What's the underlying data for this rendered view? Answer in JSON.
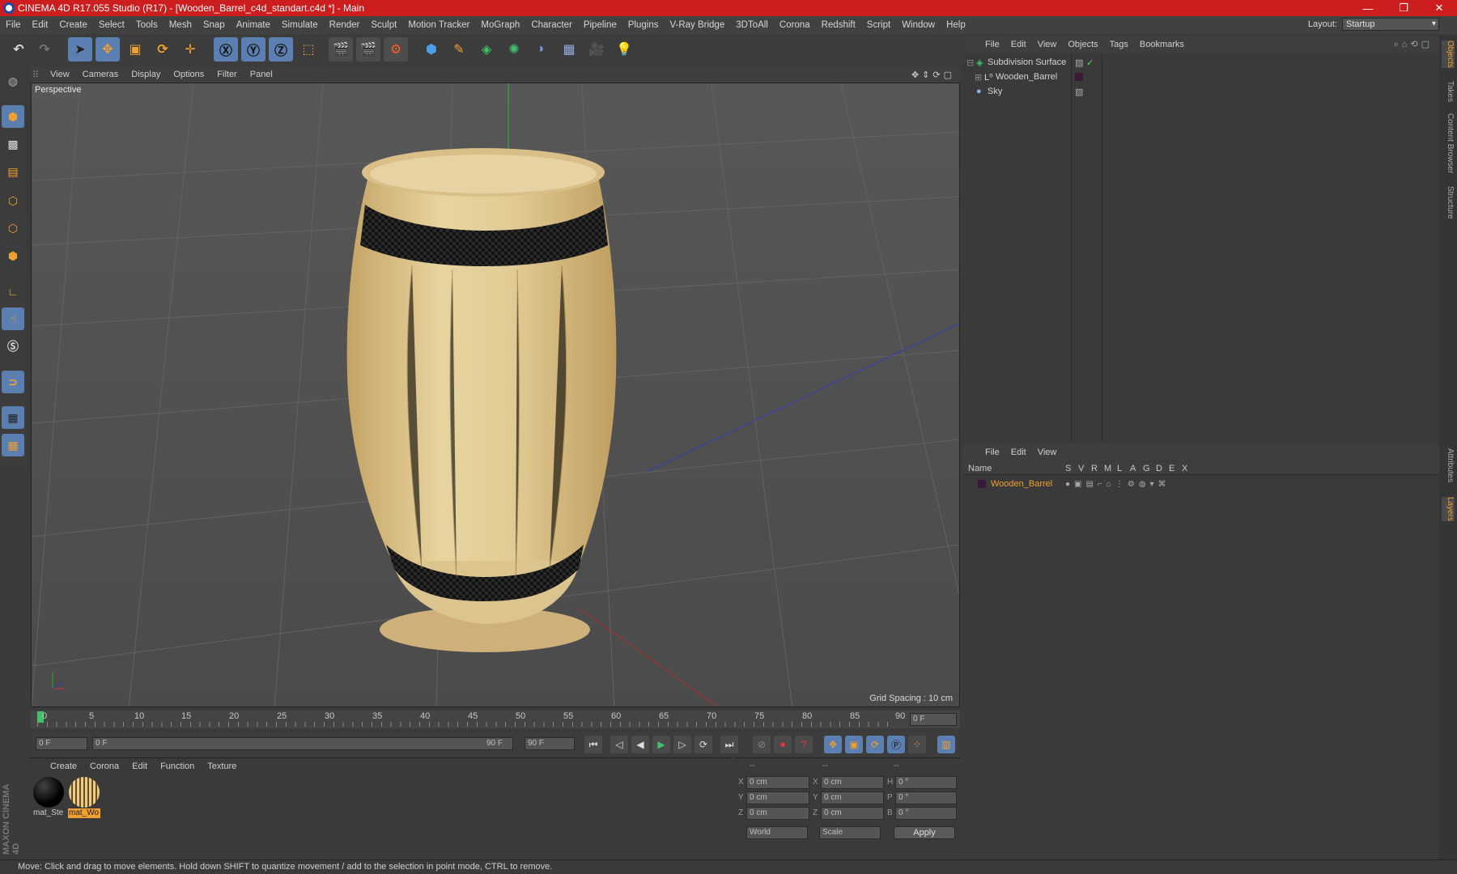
{
  "window": {
    "title": "CINEMA 4D R17.055 Studio (R17) - [Wooden_Barrel_c4d_standart.c4d *] - Main",
    "minimize": "—",
    "maximize": "❐",
    "close": "✕"
  },
  "menubar": {
    "items": [
      "File",
      "Edit",
      "Create",
      "Select",
      "Tools",
      "Mesh",
      "Snap",
      "Animate",
      "Simulate",
      "Render",
      "Sculpt",
      "Motion Tracker",
      "MoGraph",
      "Character",
      "Pipeline",
      "Plugins",
      "V-Ray Bridge",
      "3DToAll",
      "Corona",
      "Redshift",
      "Script",
      "Window",
      "Help"
    ],
    "layout_label": "Layout:",
    "layout_value": "Startup"
  },
  "viewport": {
    "menu": [
      "View",
      "Cameras",
      "Display",
      "Options",
      "Filter",
      "Panel"
    ],
    "label": "Perspective",
    "grid_spacing": "Grid Spacing : 10 cm"
  },
  "timeline": {
    "ticks": [
      "0",
      "5",
      "10",
      "15",
      "20",
      "25",
      "30",
      "35",
      "40",
      "45",
      "50",
      "55",
      "60",
      "65",
      "70",
      "75",
      "80",
      "85",
      "90"
    ],
    "current_frame": "0 F",
    "start_field": "0 F",
    "range_start": "0 F",
    "range_end": "90 F",
    "end_field": "90 F"
  },
  "materials": {
    "menu": [
      "Create",
      "Corona",
      "Edit",
      "Function",
      "Texture"
    ],
    "items": [
      {
        "label": "mat_Ste",
        "color": "#111111"
      },
      {
        "label": "mat_Wo",
        "color": "#c9a55a"
      }
    ]
  },
  "coordinates": {
    "headers": [
      "--",
      "--",
      "--"
    ],
    "rows": [
      {
        "a": "X",
        "av": "0 cm",
        "b": "X",
        "bv": "0 cm",
        "c": "H",
        "cv": "0 °"
      },
      {
        "a": "Y",
        "av": "0 cm",
        "b": "Y",
        "bv": "0 cm",
        "c": "P",
        "cv": "0 °"
      },
      {
        "a": "Z",
        "av": "0 cm",
        "b": "Z",
        "bv": "0 cm",
        "c": "B",
        "cv": "0 °"
      }
    ],
    "mode": "World",
    "scale": "Scale",
    "apply": "Apply"
  },
  "objects_panel": {
    "menu": [
      "File",
      "Edit",
      "View",
      "Objects",
      "Tags",
      "Bookmarks"
    ],
    "objects": [
      {
        "name": "Subdivision Surface"
      },
      {
        "name": "Wooden_Barrel"
      },
      {
        "name": "Sky"
      }
    ]
  },
  "layers_panel": {
    "menu": [
      "File",
      "Edit",
      "View"
    ],
    "columns": [
      "Name",
      "S",
      "V",
      "R",
      "M",
      "L",
      "A",
      "G",
      "D",
      "E",
      "X"
    ],
    "layer_name": "Wooden_Barrel"
  },
  "sidetabs": [
    "Objects",
    "Takes",
    "Content Browser",
    "Structure",
    "Attributes",
    "Layers"
  ],
  "status": "Move: Click and drag to move elements. Hold down SHIFT to quantize movement / add to the selection in point mode, CTRL to remove.",
  "brand": "MAXON CINEMA 4D",
  "colors": {
    "accent": "#5b7fb0",
    "title_bar": "#cc1d1f",
    "barrel": "#d8bd82",
    "orange": "#f0a030"
  }
}
